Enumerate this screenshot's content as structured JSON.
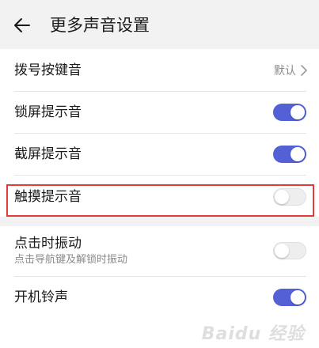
{
  "header": {
    "title": "更多声音设置"
  },
  "items": [
    {
      "title": "拨号按键音",
      "value": "默认"
    },
    {
      "title": "锁屏提示音",
      "state": "on"
    },
    {
      "title": "截屏提示音",
      "state": "on"
    },
    {
      "title": "触摸提示音",
      "state": "off"
    },
    {
      "title": "点击时振动",
      "subtitle": "点击导航键及解锁时振动",
      "state": "off"
    },
    {
      "title": "开机铃声",
      "state": "on"
    }
  ],
  "colors": {
    "accent": "#5461d6",
    "highlight": "#e53a3a"
  },
  "watermark": "Baidu 经验"
}
